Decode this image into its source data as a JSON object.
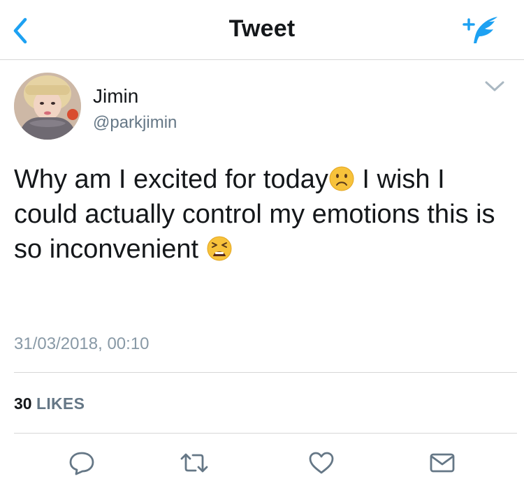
{
  "navbar": {
    "title": "Tweet",
    "back_icon": "chevron-left-icon",
    "compose_icon": "compose-tweet-icon",
    "accent_color": "#1da1f2"
  },
  "tweet": {
    "author_name": "Jimin",
    "author_handle": "@parkjimin",
    "text_part1": "Why am I excited for today",
    "text_part2": " I wish I could actually control my emotions this is so inconvenient ",
    "emoji_1": "frowning-face-emoji",
    "emoji_2": "tired-face-emoji",
    "timestamp": "31/03/2018, 00:10",
    "likes_count": "30",
    "likes_label": "LIKES"
  },
  "actions": {
    "reply_icon": "reply-icon",
    "retweet_icon": "retweet-icon",
    "like_icon": "heart-icon",
    "message_icon": "envelope-icon"
  }
}
